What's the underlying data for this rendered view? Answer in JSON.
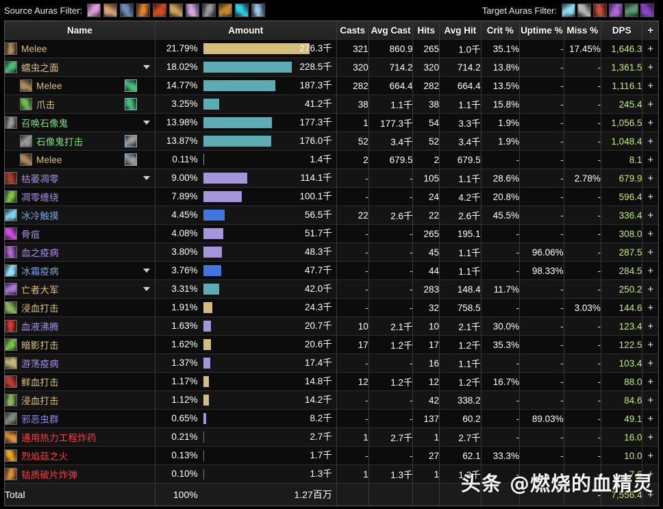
{
  "filters": {
    "source_label": "Source Auras Filter:",
    "target_label": "Target Auras Filter:",
    "source_icons": [
      {
        "name": "aura-icon-crossed-blades",
        "c1": "#d9a0d8",
        "c2": "#5b2a4d"
      },
      {
        "name": "aura-icon-flexed-arm",
        "c1": "#d8a373",
        "c2": "#3a241a"
      },
      {
        "name": "aura-icon-dark-wings",
        "c1": "#6d8fb5",
        "c2": "#1b2432"
      },
      {
        "name": "aura-icon-potion-flask",
        "c1": "#e0862e",
        "c2": "#35200d"
      },
      {
        "name": "aura-icon-red-rune",
        "c1": "#d44b22",
        "c2": "#3a1008"
      },
      {
        "name": "aura-icon-bronze-drum",
        "c1": "#c9a25c",
        "c2": "#3d2c13"
      },
      {
        "name": "aura-icon-amber-orb",
        "c1": "#d7a8e0",
        "c2": "#4a2e54"
      },
      {
        "name": "aura-icon-dark-armor",
        "c1": "#9a9a9a",
        "c2": "#1c1c1c"
      },
      {
        "name": "aura-icon-golden-eye",
        "c1": "#c78b2f",
        "c2": "#3a2409"
      },
      {
        "name": "aura-icon-cyan-claw",
        "c1": "#2fd0e8",
        "c2": "#0c2a33"
      },
      {
        "name": "aura-icon-blue-wind",
        "c1": "#9fc6e8",
        "c2": "#1e2c3c"
      }
    ],
    "target_icons": [
      {
        "name": "aura-icon-frost-crystal",
        "c1": "#8ddff5",
        "c2": "#17323e"
      },
      {
        "name": "aura-icon-grey-hook",
        "c1": "#b8b8b8",
        "c2": "#242424"
      },
      {
        "name": "aura-icon-red-flesh",
        "c1": "#c8533a",
        "c2": "#3a1310"
      },
      {
        "name": "aura-icon-purple-arm",
        "c1": "#b168d8",
        "c2": "#3a1453"
      },
      {
        "name": "aura-icon-green-beetle",
        "c1": "#5b9a74",
        "c2": "#1b2a1f"
      },
      {
        "name": "aura-icon-purple-hood",
        "c1": "#8a45c8",
        "c2": "#2a1040"
      }
    ]
  },
  "columns": [
    {
      "key": "name",
      "label": "Name"
    },
    {
      "key": "amount",
      "label": "Amount"
    },
    {
      "key": "casts",
      "label": "Casts"
    },
    {
      "key": "avg_cast",
      "label": "Avg Cast"
    },
    {
      "key": "hits",
      "label": "Hits"
    },
    {
      "key": "avg_hit",
      "label": "Avg Hit"
    },
    {
      "key": "crit",
      "label": "Crit %"
    },
    {
      "key": "uptime",
      "label": "Uptime %"
    },
    {
      "key": "miss",
      "label": "Miss %"
    },
    {
      "key": "dps",
      "label": "DPS"
    },
    {
      "key": "plus",
      "label": "+"
    }
  ],
  "rows": [
    {
      "name": "Melee",
      "name_color": "#e2c36a",
      "indent": false,
      "expand": false,
      "src_icon": false,
      "icon": {
        "name": "spell-icon-melee",
        "c1": "#b08c5a",
        "c2": "#2a1d11"
      },
      "pct": "21.79%",
      "bar_pct": 100,
      "bar_color": "#d4bd7c",
      "amount": "276.3千",
      "casts": "321",
      "avg_cast": "860.9",
      "hits": "265",
      "avg_hit": "1.0千",
      "crit": "35.1%",
      "uptime": "-",
      "miss": "17.45%",
      "dps": "1,646.3"
    },
    {
      "name": "蠕虫之面",
      "name_color": "#e2c36a",
      "indent": false,
      "expand": true,
      "src_icon": false,
      "icon": {
        "name": "spell-icon-worm-visage",
        "c1": "#49c07a",
        "c2": "#0e2a1a"
      },
      "pct": "18.02%",
      "bar_pct": 82.7,
      "bar_color": "#5cacb5",
      "amount": "228.5千",
      "casts": "320",
      "avg_cast": "714.2",
      "hits": "320",
      "avg_hit": "714.2",
      "crit": "13.8%",
      "uptime": "-",
      "miss": "-",
      "dps": "1,361.5"
    },
    {
      "name": "Melee",
      "name_color": "#e2c36a",
      "indent": true,
      "expand": false,
      "src_icon": true,
      "icon": {
        "name": "spell-icon-melee",
        "c1": "#b08c5a",
        "c2": "#2a1d11"
      },
      "src": {
        "name": "source-icon-worm-visage",
        "c1": "#49c07a",
        "c2": "#0e2a1a"
      },
      "pct": "14.77%",
      "bar_pct": 67.8,
      "bar_color": "#5cacb5",
      "amount": "187.3千",
      "casts": "282",
      "avg_cast": "664.4",
      "hits": "282",
      "avg_hit": "664.4",
      "crit": "13.5%",
      "uptime": "-",
      "miss": "-",
      "dps": "1,116.1"
    },
    {
      "name": "爪击",
      "name_color": "#e2c36a",
      "indent": true,
      "expand": false,
      "src_icon": true,
      "icon": {
        "name": "spell-icon-claw",
        "c1": "#6fbf52",
        "c2": "#1b2e14"
      },
      "src": {
        "name": "source-icon-worm-visage",
        "c1": "#49c07a",
        "c2": "#0e2a1a"
      },
      "pct": "3.25%",
      "bar_pct": 15.0,
      "bar_color": "#5cacb5",
      "amount": "41.2千",
      "casts": "38",
      "avg_cast": "1.1千",
      "hits": "38",
      "avg_hit": "1.1千",
      "crit": "15.8%",
      "uptime": "-",
      "miss": "-",
      "dps": "245.4"
    },
    {
      "name": "召唤石像鬼",
      "name_color": "#7ee07e",
      "indent": false,
      "expand": true,
      "src_icon": false,
      "icon": {
        "name": "spell-icon-summon-gargoyle",
        "c1": "#9b9b9b",
        "c2": "#242424"
      },
      "pct": "13.98%",
      "bar_pct": 64.2,
      "bar_color": "#5cacb5",
      "amount": "177.3千",
      "casts": "1",
      "avg_cast": "177.3千",
      "hits": "54",
      "avg_hit": "3.3千",
      "crit": "1.9%",
      "uptime": "-",
      "miss": "-",
      "dps": "1,056.5"
    },
    {
      "name": "石像鬼打击",
      "name_color": "#7ee07e",
      "indent": true,
      "expand": false,
      "src_icon": true,
      "icon": {
        "name": "spell-icon-gargoyle-strike",
        "c1": "#9b9b9b",
        "c2": "#242424"
      },
      "src": {
        "name": "source-icon-gargoyle",
        "c1": "#9b9b9b",
        "c2": "#242424"
      },
      "pct": "13.87%",
      "bar_pct": 63.7,
      "bar_color": "#5cacb5",
      "amount": "176.0千",
      "casts": "52",
      "avg_cast": "3.4千",
      "hits": "52",
      "avg_hit": "3.4千",
      "crit": "1.9%",
      "uptime": "-",
      "miss": "-",
      "dps": "1,048.4"
    },
    {
      "name": "Melee",
      "name_color": "#e2c36a",
      "indent": true,
      "expand": false,
      "src_icon": true,
      "icon": {
        "name": "spell-icon-melee",
        "c1": "#b08c5a",
        "c2": "#2a1d11"
      },
      "src": {
        "name": "source-icon-gargoyle",
        "c1": "#9b9b9b",
        "c2": "#242424"
      },
      "pct": "0.11%",
      "bar_pct": 0.6,
      "bar_color": "#5cacb5",
      "amount": "1.4千",
      "casts": "2",
      "avg_cast": "679.5",
      "hits": "2",
      "avg_hit": "679.5",
      "crit": "-",
      "uptime": "-",
      "miss": "-",
      "dps": "8.1"
    },
    {
      "name": "枯萎凋零",
      "name_color": "#a98ee8",
      "indent": false,
      "expand": true,
      "src_icon": false,
      "icon": {
        "name": "spell-icon-death-and-decay",
        "c1": "#a8412e",
        "c2": "#35120c"
      },
      "pct": "9.00%",
      "bar_pct": 41.3,
      "bar_color": "#a495dd",
      "amount": "114.1千",
      "casts": "-",
      "avg_cast": "-",
      "hits": "105",
      "avg_hit": "1.1千",
      "crit": "28.6%",
      "uptime": "-",
      "miss": "2.78%",
      "dps": "679.9"
    },
    {
      "name": "凋零缠绕",
      "name_color": "#a98ee8",
      "indent": false,
      "expand": false,
      "src_icon": false,
      "icon": {
        "name": "spell-icon-death-coil",
        "c1": "#7bc94a",
        "c2": "#1d3312"
      },
      "pct": "7.89%",
      "bar_pct": 36.2,
      "bar_color": "#a495dd",
      "amount": "100.1千",
      "casts": "-",
      "avg_cast": "-",
      "hits": "24",
      "avg_hit": "4.2千",
      "crit": "20.8%",
      "uptime": "-",
      "miss": "-",
      "dps": "596.4"
    },
    {
      "name": "冰冷触摸",
      "name_color": "#6fa8ea",
      "indent": false,
      "expand": false,
      "src_icon": false,
      "icon": {
        "name": "spell-icon-icy-touch",
        "c1": "#7fd6f0",
        "c2": "#142c3a"
      },
      "pct": "4.45%",
      "bar_pct": 20.4,
      "bar_color": "#4176e0",
      "amount": "56.5千",
      "casts": "22",
      "avg_cast": "2.6千",
      "hits": "22",
      "avg_hit": "2.6千",
      "crit": "45.5%",
      "uptime": "-",
      "miss": "-",
      "dps": "336.4"
    },
    {
      "name": "骨疽",
      "name_color": "#a98ee8",
      "indent": false,
      "expand": false,
      "src_icon": false,
      "icon": {
        "name": "spell-icon-necrosis",
        "c1": "#d34be0",
        "c2": "#3d0f45"
      },
      "pct": "4.08%",
      "bar_pct": 18.7,
      "bar_color": "#a495dd",
      "amount": "51.7千",
      "casts": "-",
      "avg_cast": "-",
      "hits": "265",
      "avg_hit": "195.1",
      "crit": "-",
      "uptime": "-",
      "miss": "-",
      "dps": "308.0"
    },
    {
      "name": "血之疫病",
      "name_color": "#a98ee8",
      "indent": false,
      "expand": false,
      "src_icon": false,
      "icon": {
        "name": "spell-icon-blood-plague",
        "c1": "#b06ad0",
        "c2": "#331342"
      },
      "pct": "3.80%",
      "bar_pct": 17.4,
      "bar_color": "#a495dd",
      "amount": "48.3千",
      "casts": "-",
      "avg_cast": "-",
      "hits": "45",
      "avg_hit": "1.1千",
      "crit": "-",
      "uptime": "96.06%",
      "miss": "-",
      "dps": "287.5"
    },
    {
      "name": "冰霜疫病",
      "name_color": "#6fa8ea",
      "indent": false,
      "expand": true,
      "src_icon": false,
      "icon": {
        "name": "spell-icon-frost-fever",
        "c1": "#8fe4f7",
        "c2": "#16303d"
      },
      "pct": "3.76%",
      "bar_pct": 17.2,
      "bar_color": "#4176e0",
      "amount": "47.7千",
      "casts": "-",
      "avg_cast": "-",
      "hits": "44",
      "avg_hit": "1.1千",
      "crit": "-",
      "uptime": "98.33%",
      "miss": "-",
      "dps": "284.5"
    },
    {
      "name": "亡者大军",
      "name_color": "#e2c36a",
      "indent": false,
      "expand": true,
      "src_icon": false,
      "icon": {
        "name": "spell-icon-army-of-the-dead",
        "c1": "#a87ad8",
        "c2": "#2e1844"
      },
      "pct": "3.31%",
      "bar_pct": 15.2,
      "bar_color": "#5cacb5",
      "amount": "42.0千",
      "casts": "-",
      "avg_cast": "-",
      "hits": "283",
      "avg_hit": "148.4",
      "crit": "11.7%",
      "uptime": "-",
      "miss": "-",
      "dps": "250.2"
    },
    {
      "name": "浸血打击",
      "name_color": "#e2c36a",
      "indent": false,
      "expand": false,
      "src_icon": false,
      "icon": {
        "name": "spell-icon-blood-strike-a",
        "c1": "#8fb95e",
        "c2": "#222c13"
      },
      "pct": "1.91%",
      "bar_pct": 8.8,
      "bar_color": "#d4bd7c",
      "amount": "24.3千",
      "casts": "-",
      "avg_cast": "-",
      "hits": "32",
      "avg_hit": "758.5",
      "crit": "-",
      "uptime": "-",
      "miss": "3.03%",
      "dps": "144.6"
    },
    {
      "name": "血液沸腾",
      "name_color": "#a98ee8",
      "indent": false,
      "expand": false,
      "src_icon": false,
      "icon": {
        "name": "spell-icon-blood-boil",
        "c1": "#d23a32",
        "c2": "#3d0d0b"
      },
      "pct": "1.63%",
      "bar_pct": 7.5,
      "bar_color": "#a495dd",
      "amount": "20.7千",
      "casts": "10",
      "avg_cast": "2.1千",
      "hits": "10",
      "avg_hit": "2.1千",
      "crit": "30.0%",
      "uptime": "-",
      "miss": "-",
      "dps": "123.4"
    },
    {
      "name": "暗影打击",
      "name_color": "#e2c36a",
      "indent": false,
      "expand": false,
      "src_icon": false,
      "icon": {
        "name": "spell-icon-shadow-strike",
        "c1": "#79c14a",
        "c2": "#1e3113"
      },
      "pct": "1.62%",
      "bar_pct": 7.4,
      "bar_color": "#d4bd7c",
      "amount": "20.6千",
      "casts": "17",
      "avg_cast": "1.2千",
      "hits": "17",
      "avg_hit": "1.2千",
      "crit": "35.3%",
      "uptime": "-",
      "miss": "-",
      "dps": "122.5"
    },
    {
      "name": "游荡疫病",
      "name_color": "#a98ee8",
      "indent": false,
      "expand": false,
      "src_icon": false,
      "icon": {
        "name": "spell-icon-wandering-plague",
        "c1": "#c6bb7a",
        "c2": "#32301a"
      },
      "pct": "1.37%",
      "bar_pct": 6.3,
      "bar_color": "#a495dd",
      "amount": "17.4千",
      "casts": "-",
      "avg_cast": "-",
      "hits": "16",
      "avg_hit": "1.1千",
      "crit": "-",
      "uptime": "-",
      "miss": "-",
      "dps": "103.4"
    },
    {
      "name": "鲜血打击",
      "name_color": "#e2c36a",
      "indent": false,
      "expand": false,
      "src_icon": false,
      "icon": {
        "name": "spell-icon-heart-strike",
        "c1": "#c23a34",
        "c2": "#3a0e0c"
      },
      "pct": "1.17%",
      "bar_pct": 5.4,
      "bar_color": "#d4bd7c",
      "amount": "14.8千",
      "casts": "12",
      "avg_cast": "1.2千",
      "hits": "12",
      "avg_hit": "1.2千",
      "crit": "16.7%",
      "uptime": "-",
      "miss": "-",
      "dps": "88.0"
    },
    {
      "name": "浸血打击",
      "name_color": "#e2c36a",
      "indent": false,
      "expand": false,
      "src_icon": false,
      "icon": {
        "name": "spell-icon-blood-strike-b",
        "c1": "#8fb95e",
        "c2": "#222c13"
      },
      "pct": "1.12%",
      "bar_pct": 5.1,
      "bar_color": "#d4bd7c",
      "amount": "14.2千",
      "casts": "-",
      "avg_cast": "-",
      "hits": "42",
      "avg_hit": "338.2",
      "crit": "-",
      "uptime": "-",
      "miss": "-",
      "dps": "84.6"
    },
    {
      "name": "邪恶虫群",
      "name_color": "#8f8ce8",
      "indent": false,
      "expand": false,
      "src_icon": false,
      "icon": {
        "name": "spell-icon-unholy-blight",
        "c1": "#7f8f7a",
        "c2": "#1f2720"
      },
      "pct": "0.65%",
      "bar_pct": 3.0,
      "bar_color": "#a495dd",
      "amount": "8.2千",
      "casts": "-",
      "avg_cast": "-",
      "hits": "137",
      "avg_hit": "60.2",
      "crit": "-",
      "uptime": "89.03%",
      "miss": "-",
      "dps": "49.1"
    },
    {
      "name": "通用热力工程炸药",
      "name_color": "#ff3b3b",
      "indent": false,
      "expand": false,
      "src_icon": false,
      "icon": {
        "name": "spell-icon-global-thermal-sapper",
        "c1": "#e0913a",
        "c2": "#3d1c08"
      },
      "pct": "0.21%",
      "bar_pct": 1.0,
      "bar_color": "#d05555",
      "amount": "2.7千",
      "casts": "1",
      "avg_cast": "2.7千",
      "hits": "1",
      "avg_hit": "2.7千",
      "crit": "-",
      "uptime": "-",
      "miss": "-",
      "dps": "16.0"
    },
    {
      "name": "烈焰菇之火",
      "name_color": "#ff3b3b",
      "indent": false,
      "expand": false,
      "src_icon": false,
      "icon": {
        "name": "spell-icon-flame-cap",
        "c1": "#e8a526",
        "c2": "#3d2405"
      },
      "pct": "0.13%",
      "bar_pct": 0.7,
      "bar_color": "#d05555",
      "amount": "1.7千",
      "casts": "-",
      "avg_cast": "-",
      "hits": "27",
      "avg_hit": "62.1",
      "crit": "33.3%",
      "uptime": "-",
      "miss": "-",
      "dps": "10.0"
    },
    {
      "name": "钴质破片炸弹",
      "name_color": "#ff3b3b",
      "indent": false,
      "expand": false,
      "src_icon": false,
      "icon": {
        "name": "spell-icon-cobalt-frag-bomb",
        "c1": "#e0913a",
        "c2": "#3d1c08"
      },
      "pct": "0.10%",
      "bar_pct": 0.6,
      "bar_color": "#d05555",
      "amount": "1.3千",
      "casts": "1",
      "avg_cast": "1.3千",
      "hits": "1",
      "avg_hit": "1.3千",
      "crit": "-",
      "uptime": "-",
      "miss": "-",
      "dps": "7.6"
    }
  ],
  "total": {
    "label": "Total",
    "pct": "100%",
    "amount": "1.27百万",
    "casts": "",
    "avg_cast": "",
    "hits": "",
    "avg_hit": "",
    "crit": "",
    "uptime": "",
    "miss": "-",
    "dps": "7,556.4",
    "plus": "+"
  },
  "watermark": "头条 @燃烧的血精灵",
  "plus_glyph": "+"
}
